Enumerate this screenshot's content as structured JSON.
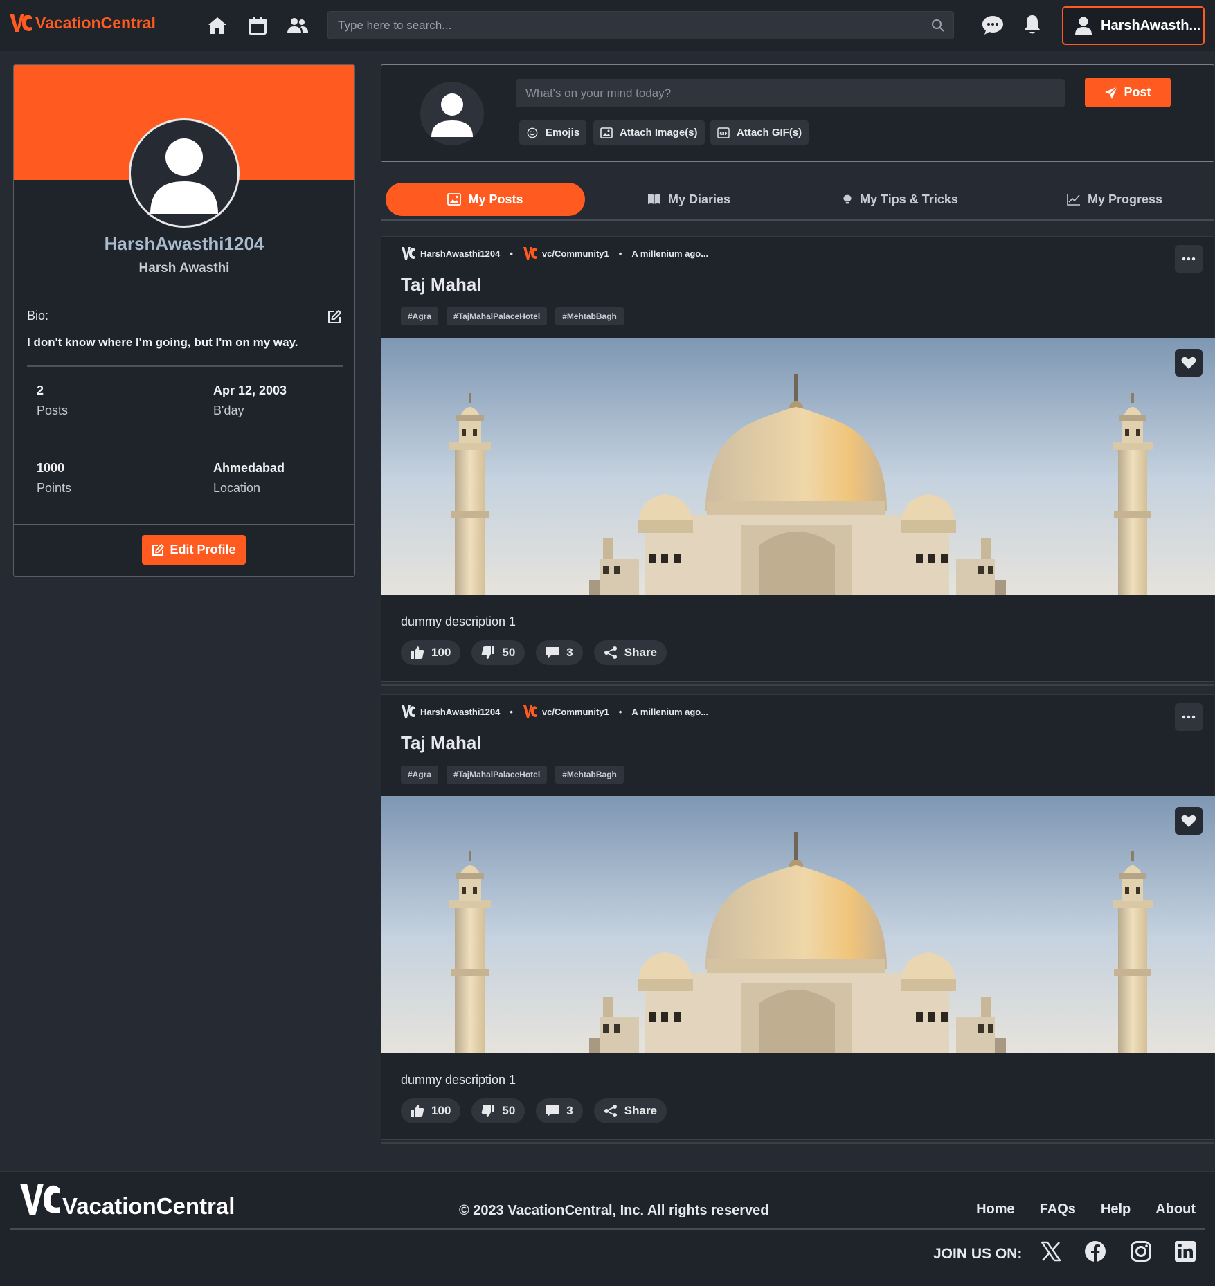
{
  "app": {
    "brand": "VacationCentral",
    "accent": "#ff5a1f",
    "background": "#262b33"
  },
  "navbar": {
    "icons": [
      "home-icon",
      "calendar-icon",
      "users-icon",
      "chat-icon",
      "bell-icon"
    ],
    "search_placeholder": "Type here to search...",
    "user_label": "HarshAwasth..."
  },
  "profile": {
    "username": "HarshAwasthi1204",
    "full_name": "Harsh Awasthi",
    "bio_label": "Bio:",
    "bio": "I don't know where I'm going, but I'm on my way.",
    "stats": [
      {
        "value": "2",
        "label": "Posts"
      },
      {
        "value": "Apr 12, 2003",
        "label": "B'day"
      },
      {
        "value": "1000",
        "label": "Points"
      },
      {
        "value": "Ahmedabad",
        "label": "Location"
      }
    ],
    "edit_label": "Edit Profile"
  },
  "composer": {
    "placeholder": "What's on your mind today?",
    "post_label": "Post",
    "attach": [
      "Emojis",
      "Attach Image(s)",
      "Attach GIF(s)"
    ]
  },
  "tabs": [
    {
      "label": "My Posts",
      "active": true
    },
    {
      "label": "My Diaries",
      "active": false
    },
    {
      "label": "My Tips & Tricks",
      "active": false
    },
    {
      "label": "My Progress",
      "active": false
    }
  ],
  "posts": [
    {
      "author": "HarshAwasthi1204",
      "community": "vc/Community1",
      "time": "A millenium ago...",
      "title": "Taj Mahal",
      "tags": [
        "#Agra",
        "#TajMahalPalaceHotel",
        "#MehtabBagh"
      ],
      "description": "dummy description 1",
      "likes": "100",
      "dislikes": "50",
      "comments": "3",
      "share_label": "Share"
    },
    {
      "author": "HarshAwasthi1204",
      "community": "vc/Community1",
      "time": "A millenium ago...",
      "title": "Taj Mahal",
      "tags": [
        "#Agra",
        "#TajMahalPalaceHotel",
        "#MehtabBagh"
      ],
      "description": "dummy description 1",
      "likes": "100",
      "dislikes": "50",
      "comments": "3",
      "share_label": "Share"
    }
  ],
  "footer": {
    "brand": "VacationCentral",
    "copyright": "© 2023 VacationCentral, Inc. All rights reserved",
    "links": [
      "Home",
      "FAQs",
      "Help",
      "About"
    ],
    "join_label": "JOIN US ON:",
    "social": [
      "x-icon",
      "facebook-icon",
      "instagram-icon",
      "linkedin-icon"
    ]
  }
}
